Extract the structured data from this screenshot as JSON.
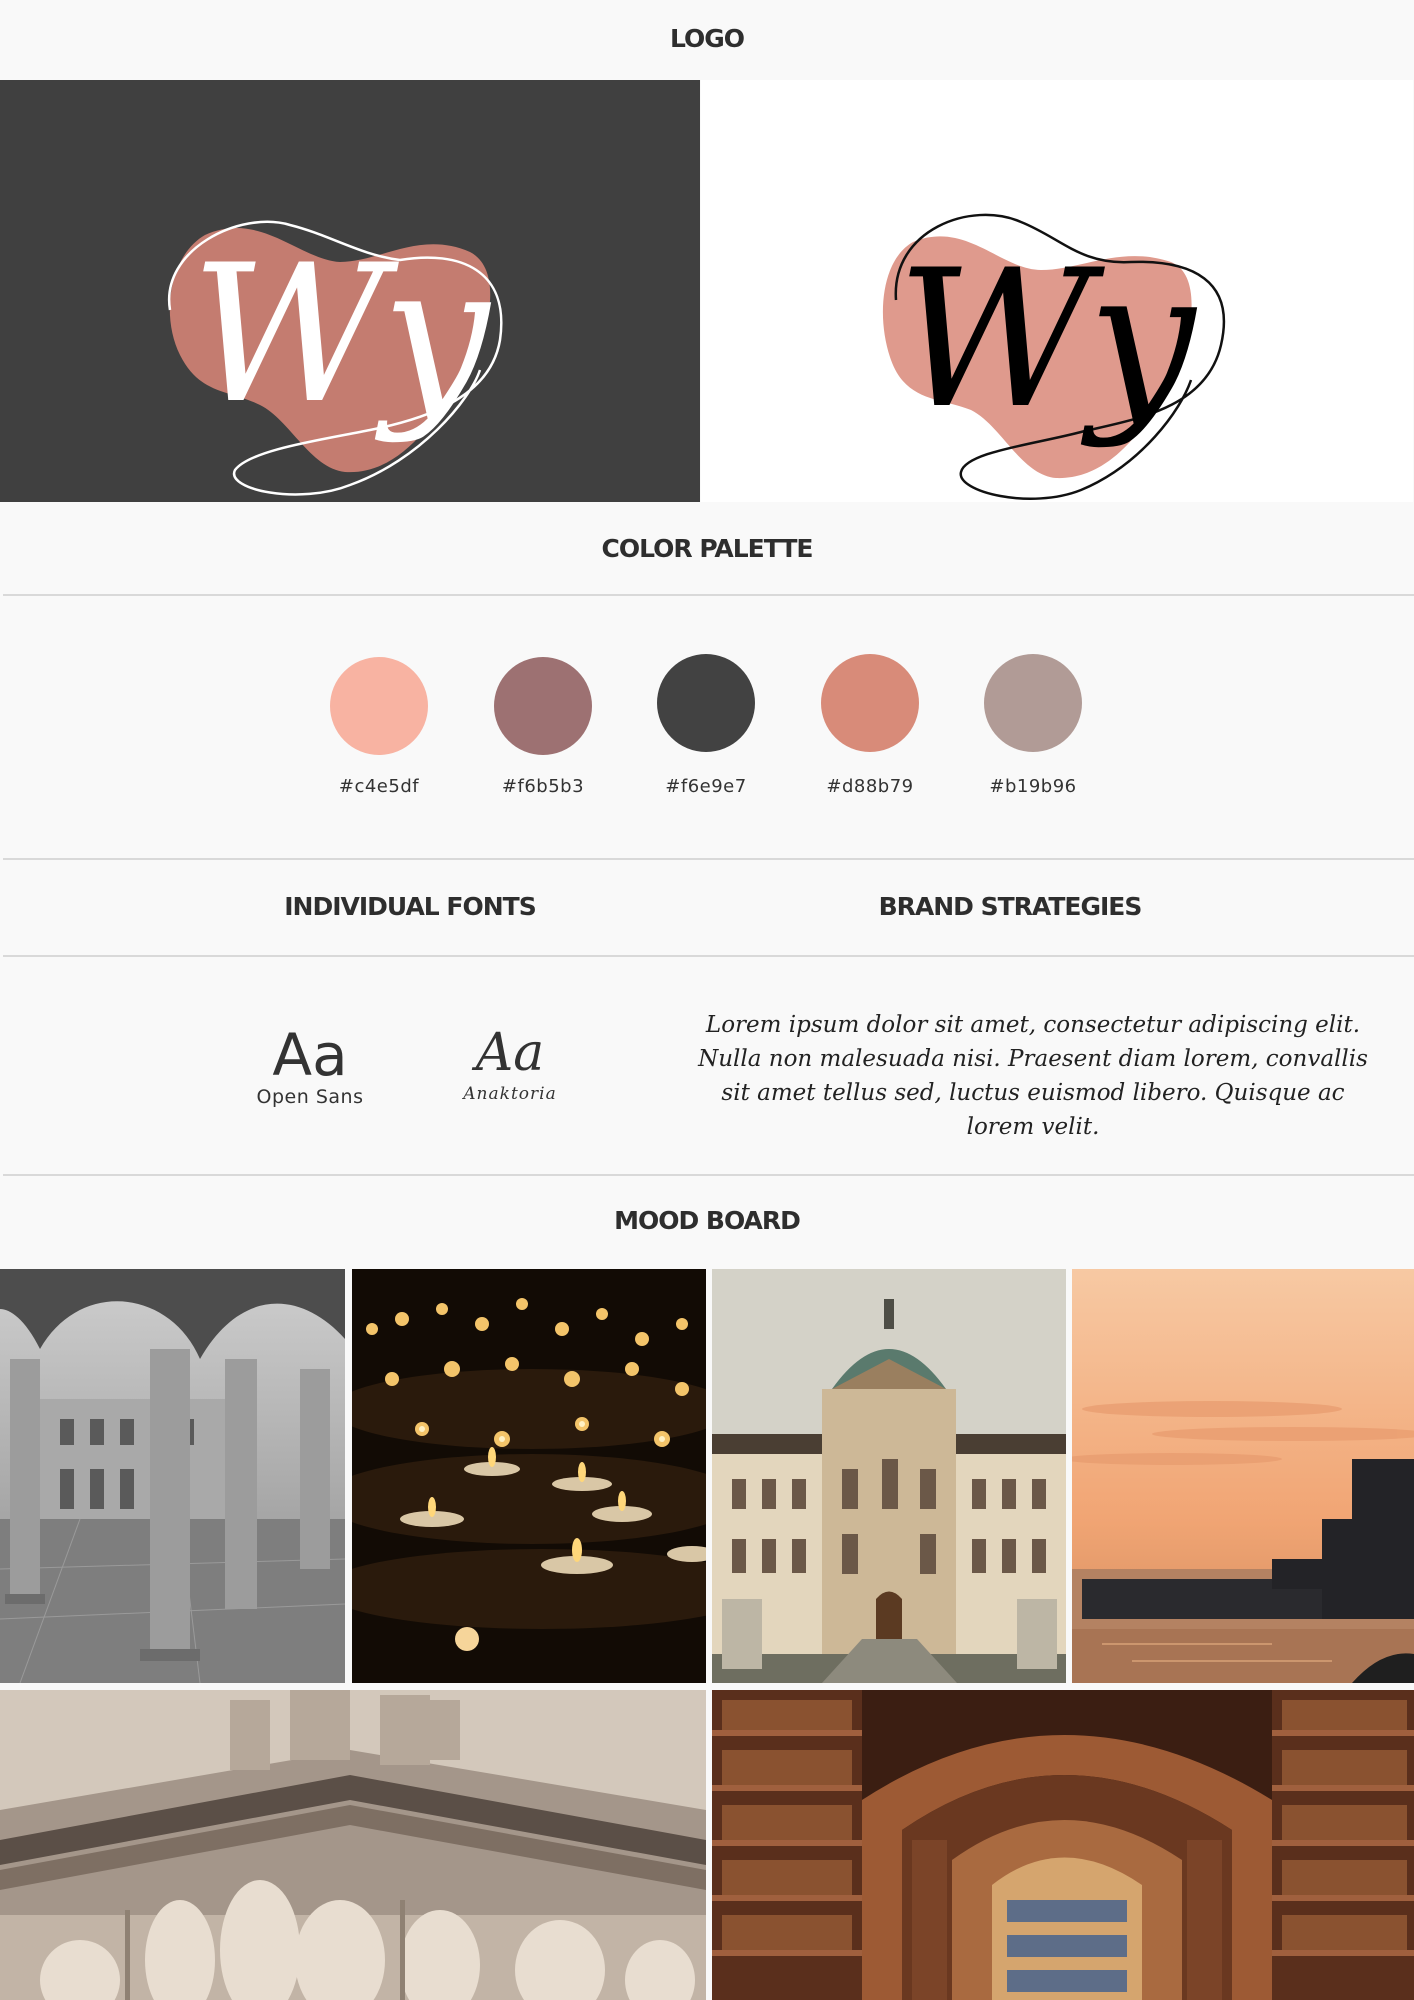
{
  "sections": {
    "logo": "LOGO",
    "color_palette": "COLOR PALETTE",
    "individual_fonts": "INDIVIDUAL FONTS",
    "brand_strategies": "BRAND STRATEGIES",
    "mood_board": "MOOD BOARD"
  },
  "logo": {
    "monogram": "Wy",
    "colors": {
      "dark_bg": "#404040",
      "dark_blob": "#c47c70",
      "light_bg": "#ffffff",
      "light_blob": "#df9a8d"
    }
  },
  "palette": [
    {
      "label": "#c4e5df",
      "color": "#f8b3a2"
    },
    {
      "label": "#f6b5b3",
      "color": "#9d7172"
    },
    {
      "label": "#f6e9e7",
      "color": "#424242"
    },
    {
      "label": "#d88b79",
      "color": "#d88b79"
    },
    {
      "label": "#b19b96",
      "color": "#b19b96"
    }
  ],
  "fonts": [
    {
      "sample": "Aa",
      "name": "Open Sans"
    },
    {
      "sample": "Aa",
      "name": "Anaktoria"
    }
  ],
  "brand_strategy_text": "Lorem ipsum dolor sit amet, consectetur adipiscing elit. Nulla non malesuada nisi. Praesent diam lorem, convallis sit amet tellus sed, luctus euismod libero. Quisque ac lorem velit.",
  "mood_board": [
    {
      "icon": "arched-courtyard-photo"
    },
    {
      "icon": "tealight-candles-photo"
    },
    {
      "icon": "domed-palace-photo"
    },
    {
      "icon": "harbor-sunset-photo"
    },
    {
      "icon": "classical-pediment-sculpture-photo"
    },
    {
      "icon": "arched-library-photo"
    }
  ]
}
